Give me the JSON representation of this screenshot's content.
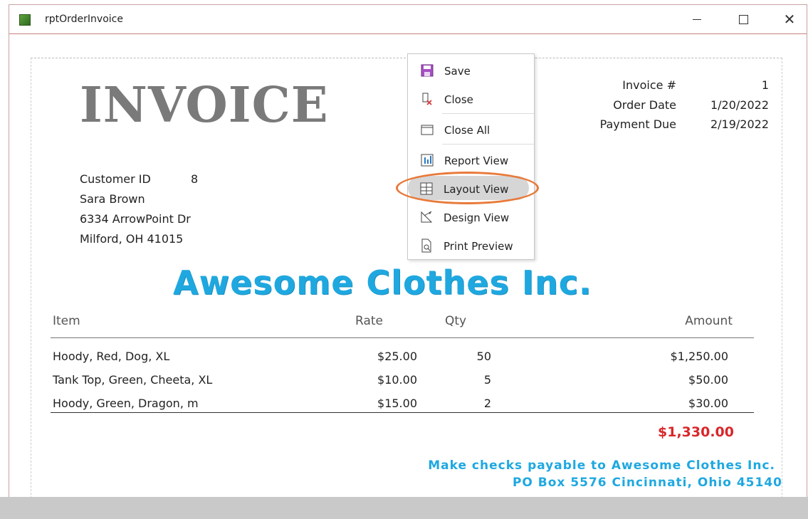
{
  "window": {
    "title": "rptOrderInvoice",
    "controls": [
      "minimize",
      "maximize",
      "close"
    ]
  },
  "report": {
    "heading": "INVOICE",
    "meta": [
      {
        "label": "Invoice #",
        "value": "1"
      },
      {
        "label": "Order Date",
        "value": "1/20/2022"
      },
      {
        "label": "Payment Due",
        "value": "2/19/2022"
      }
    ],
    "customer": {
      "id_label": "Customer ID",
      "id_value": "8",
      "name": "Sara Brown",
      "street": "6334 ArrowPoint Dr",
      "city": "Milford, OH 41015"
    },
    "brand": "Awesome Clothes Inc.",
    "table": {
      "headers": {
        "item": "Item",
        "rate": "Rate",
        "qty": "Qty",
        "amount": "Amount"
      },
      "rows": [
        {
          "item": "Hoody, Red, Dog, XL",
          "rate": "$25.00",
          "qty": "50",
          "amount": "$1,250.00"
        },
        {
          "item": "Tank Top, Green, Cheeta, XL",
          "rate": "$10.00",
          "qty": "5",
          "amount": "$50.00"
        },
        {
          "item": "Hoody, Green, Dragon, m",
          "rate": "$15.00",
          "qty": "2",
          "amount": "$30.00"
        }
      ],
      "total": "$1,330.00"
    },
    "footer": {
      "line1": "Make checks payable to Awesome Clothes Inc.",
      "line2": "PO Box 5576 Cincinnati, Ohio 45140"
    }
  },
  "context_menu": {
    "items": [
      {
        "label": "Save",
        "icon": "save-icon"
      },
      {
        "label": "Close",
        "icon": "close-doc-icon"
      },
      {
        "label": "Close All",
        "icon": "close-all-icon"
      },
      {
        "label": "Report View",
        "icon": "report-view-icon"
      },
      {
        "label": "Layout View",
        "icon": "layout-view-icon"
      },
      {
        "label": "Design View",
        "icon": "design-view-icon"
      },
      {
        "label": "Print Preview",
        "icon": "print-preview-icon"
      }
    ],
    "highlighted": "Layout View"
  },
  "colors": {
    "brand": "#1fa8e0",
    "total": "#d9262a",
    "highlight_ring": "#e87a3a",
    "heading": "#7a7a7a"
  }
}
